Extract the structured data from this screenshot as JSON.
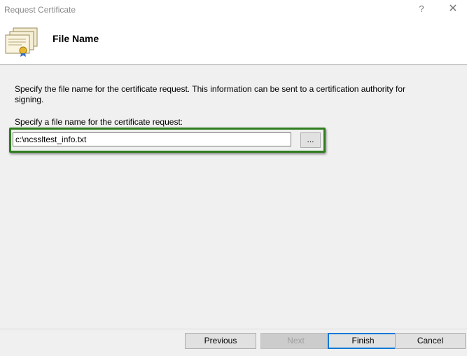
{
  "window": {
    "title": "Request Certificate",
    "help_glyph": "?",
    "close_glyph": "✕"
  },
  "header": {
    "heading": "File Name",
    "icon": "certificate-icon"
  },
  "main": {
    "description": "Specify the file name for the certificate request. This information can be sent to a certification authority for signing.",
    "field_label": "Specify a file name for the certificate request:",
    "file_value": "c:\\ncssltest_info.txt",
    "browse_label": "...",
    "highlight_color": "#2f7d1f"
  },
  "footer": {
    "previous_label": "Previous",
    "next_label": "Next",
    "finish_label": "Finish",
    "cancel_label": "Cancel"
  }
}
